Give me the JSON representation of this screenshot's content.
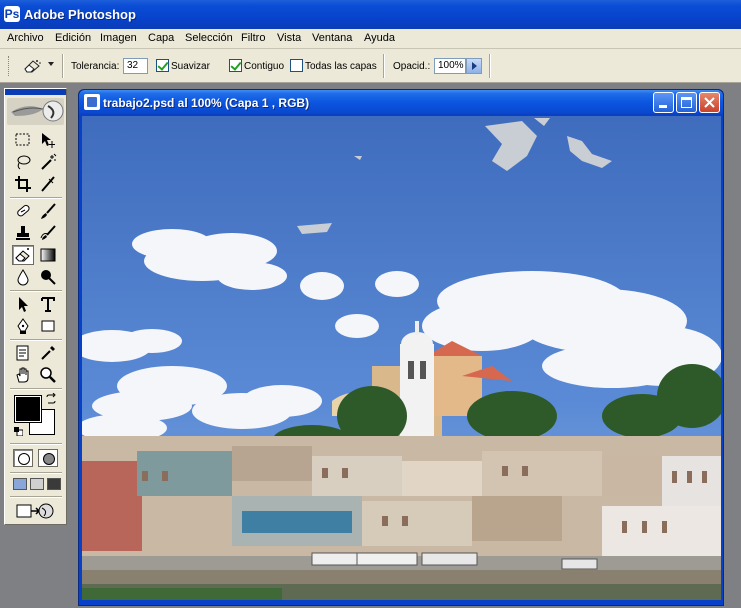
{
  "app": {
    "title": "Adobe Photoshop"
  },
  "menu": [
    "Archivo",
    "Edición",
    "Imagen",
    "Capa",
    "Selección",
    "Filtro",
    "Vista",
    "Ventana",
    "Ayuda"
  ],
  "options": {
    "tolerance_label": "Tolerancia:",
    "tolerance_value": "32",
    "smooth_label": "Suavizar",
    "smooth_checked": true,
    "contiguous_label": "Contiguo",
    "contiguous_checked": true,
    "all_layers_label": "Todas las capas",
    "all_layers_checked": false,
    "opacity_label": "Opacid.:",
    "opacity_value": "100%"
  },
  "document": {
    "title": "trabajo2.psd al 100% (Capa 1 , RGB)"
  },
  "colors": {
    "foreground": "#000000",
    "background": "#ffffff",
    "sky": "#4a78c4"
  },
  "tools": [
    "marquee-icon",
    "move-icon",
    "lasso-icon",
    "magic-wand-icon",
    "crop-icon",
    "slice-icon",
    "healing-brush-icon",
    "brush-icon",
    "clone-stamp-icon",
    "history-brush-icon",
    "magic-eraser-icon",
    "gradient-icon",
    "blur-icon",
    "dodge-icon",
    "path-selection-icon",
    "type-icon",
    "pen-icon",
    "shape-icon",
    "notes-icon",
    "eyedropper-icon",
    "hand-icon",
    "zoom-icon"
  ]
}
